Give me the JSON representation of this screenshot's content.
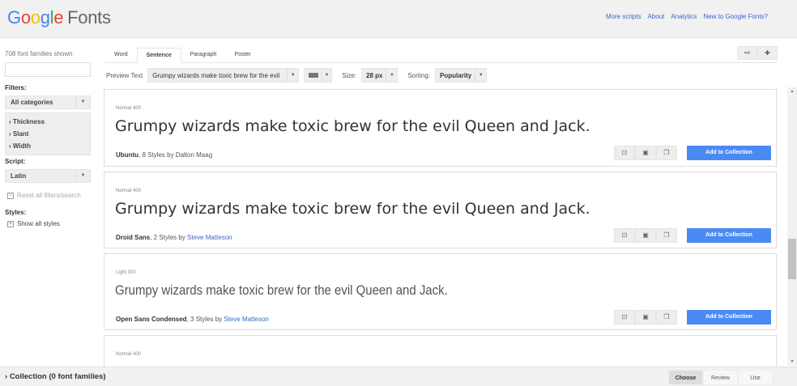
{
  "header": {
    "logo_google": "Google",
    "logo_fonts": "Fonts",
    "links": [
      "More scripts",
      "About",
      "Analytics",
      "New to Google Fonts?"
    ]
  },
  "sidebar": {
    "count": "708 font families shown",
    "search_value": "",
    "filters_label": "Filters:",
    "category": "All categories",
    "filter_items": [
      "Thickness",
      "Slant",
      "Width"
    ],
    "script_label": "Script:",
    "script": "Latin",
    "reset": "Reset all filters/search",
    "styles_label": "Styles:",
    "show_styles": "Show all styles"
  },
  "tabs": [
    "Word",
    "Sentence",
    "Paragraph",
    "Poster"
  ],
  "toolbar": {
    "link_icon": "link-icon",
    "plus_icon": "plus-icon"
  },
  "preview": {
    "label": "Preview Text",
    "text": "Grumpy wizards make toxic brew for the evil",
    "size_label": "Size:",
    "size": "28 px",
    "sorting_label": "Sorting:",
    "sorting": "Popularity"
  },
  "cards": [
    {
      "style": "Normal 400",
      "sample": "Grumpy wizards make toxic brew for the evil Queen and Jack.",
      "name": "Ubuntu",
      "styles": ", 8 Styles by ",
      "author": "Dalton Maag",
      "author_link": false,
      "add": "Add to Collection"
    },
    {
      "style": "Normal 400",
      "sample": "Grumpy wizards make toxic brew for the evil Queen and Jack.",
      "name": "Droid Sans",
      "styles": ", 2 Styles by ",
      "author": "Steve Matteson",
      "author_link": true,
      "add": "Add to Collection"
    },
    {
      "style": "Light 300",
      "sample": "Grumpy wizards make toxic brew for the evil Queen and Jack.",
      "name": "Open Sans Condensed",
      "styles": ", 3 Styles by ",
      "author": "Steve Matteson",
      "author_link": true,
      "add": "Add to Collection"
    },
    {
      "style": "Normal 400"
    }
  ],
  "footer": {
    "collection": "Collection (0 font families)",
    "tabs": [
      "Choose",
      "Review",
      "Use"
    ]
  },
  "colors": {
    "accent": "#4a8af4",
    "link": "#3b66c9"
  }
}
